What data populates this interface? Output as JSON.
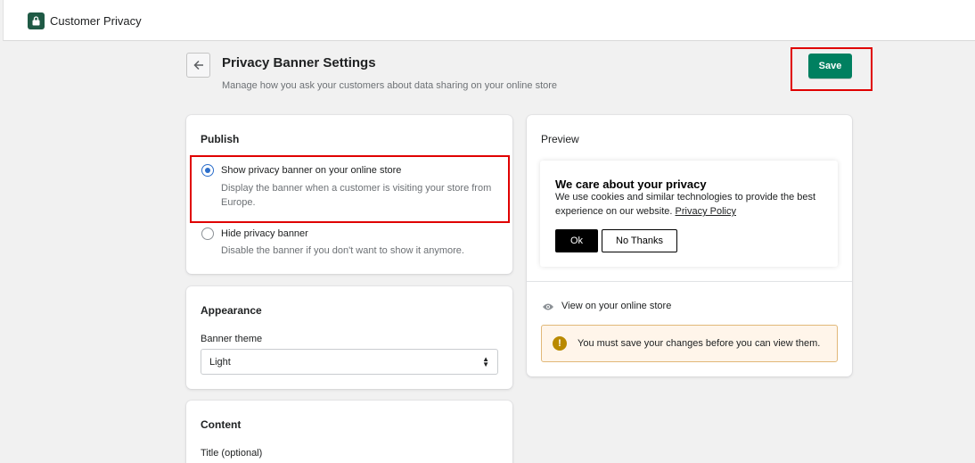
{
  "topbar": {
    "app_title": "Customer Privacy",
    "app_icon": "lock-bag-icon"
  },
  "header": {
    "back_icon": "arrow-left-icon",
    "title": "Privacy Banner Settings",
    "subtitle": "Manage how you ask your customers about data sharing on your online store",
    "save_label": "Save"
  },
  "publish": {
    "title": "Publish",
    "options": [
      {
        "label": "Show privacy banner on your online store",
        "help": "Display the banner when a customer is visiting your store from Europe.",
        "checked": true
      },
      {
        "label": "Hide privacy banner",
        "help": "Disable the banner if you don't want to show it anymore.",
        "checked": false
      }
    ]
  },
  "appearance": {
    "title": "Appearance",
    "theme_label": "Banner theme",
    "theme_value": "Light"
  },
  "content": {
    "title": "Content",
    "title_field_label": "Title (optional)"
  },
  "preview": {
    "title": "Preview",
    "banner": {
      "heading": "We care about your privacy",
      "text": "We use cookies and similar technologies to provide the best experience on our website.",
      "policy_link": "Privacy Policy",
      "ok_label": "Ok",
      "no_thanks_label": "No Thanks"
    },
    "view_link": "View on your online store",
    "view_icon": "eye-icon",
    "notice_text": "You must save your changes before you can view them.",
    "notice_icon": "warning-icon"
  },
  "colors": {
    "save": "#008060",
    "highlight": "#e00000",
    "radio": "#2c6ecb",
    "notice_bg": "#fff5ea"
  }
}
